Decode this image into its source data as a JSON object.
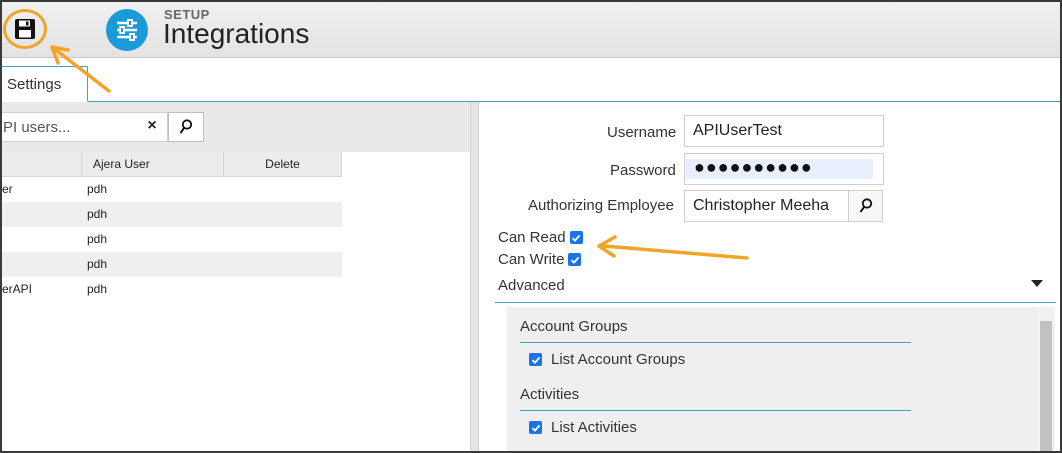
{
  "header": {
    "section_label": "SETUP",
    "title": "Integrations",
    "save_icon": "floppy-disk-icon",
    "app_icon": "sliders-icon",
    "accent_color": "#1a9bd7",
    "highlight_color": "#f0a526"
  },
  "tabs": [
    {
      "label": "Settings"
    }
  ],
  "search": {
    "value": "PI users...",
    "clear_label": "×"
  },
  "users_grid": {
    "columns": [
      "",
      "Ajera User",
      "Delete"
    ],
    "rows": [
      {
        "name": "er",
        "ajera_user": "pdh",
        "delete": ""
      },
      {
        "name": "",
        "ajera_user": "pdh",
        "delete": ""
      },
      {
        "name": "",
        "ajera_user": "pdh",
        "delete": ""
      },
      {
        "name": "",
        "ajera_user": "pdh",
        "delete": ""
      },
      {
        "name": "erAPI",
        "ajera_user": "pdh",
        "delete": ""
      }
    ]
  },
  "form": {
    "username_label": "Username",
    "username_value": "APIUserTest",
    "password_label": "Password",
    "password_mask": "●●●●●●●●●●",
    "employee_label": "Authorizing Employee",
    "employee_value": "Christopher Meeha",
    "can_read_label": "Can Read",
    "can_read_checked": true,
    "can_write_label": "Can Write",
    "can_write_checked": true,
    "advanced_label": "Advanced"
  },
  "advanced_groups": [
    {
      "title": "Account Groups",
      "permission": "List Account Groups",
      "checked": true
    },
    {
      "title": "Activities",
      "permission": "List Activities",
      "checked": true
    }
  ]
}
